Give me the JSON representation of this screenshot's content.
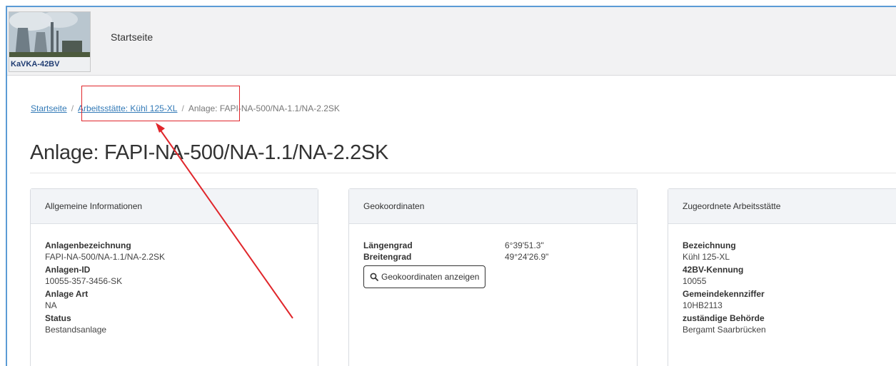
{
  "app": {
    "logo_text": "KaVKA-42BV",
    "nav_home": "Startseite"
  },
  "breadcrumb": {
    "home": "Startseite",
    "worksite": "Arbeitsstätte: Kühl 125-XL",
    "current": "Anlage: FAPI-NA-500/NA-1.1/NA-2.2SK",
    "separator": "/"
  },
  "page_title": "Anlage: FAPI-NA-500/NA-1.1/NA-2.2SK",
  "cards": {
    "general": {
      "title": "Allgemeine Informationen",
      "fields": [
        {
          "label": "Anlagenbezeichnung",
          "value": "FAPI-NA-500/NA-1.1/NA-2.2SK"
        },
        {
          "label": "Anlagen-ID",
          "value": "10055-357-3456-SK"
        },
        {
          "label": "Anlage Art",
          "value": "NA"
        },
        {
          "label": "Status",
          "value": "Bestandsanlage"
        }
      ]
    },
    "geo": {
      "title": "Geokoordinaten",
      "longitude_label": "Längengrad",
      "longitude_value": "6°39'51.3\"",
      "latitude_label": "Breitengrad",
      "latitude_value": "49°24'26.9\"",
      "button_label": "Geokoordinaten anzeigen"
    },
    "worksite": {
      "title": "Zugeordnete Arbeitsstätte",
      "fields": [
        {
          "label": "Bezeichnung",
          "value": "Kühl 125-XL"
        },
        {
          "label": "42BV-Kennung",
          "value": "10055"
        },
        {
          "label": "Gemeindekennziffer",
          "value": "10HB2113"
        },
        {
          "label": "zuständige Behörde",
          "value": "Bergamt Saarbrücken"
        }
      ]
    }
  },
  "colors": {
    "annotation": "#e0262b",
    "link": "#337ab7",
    "card_header_bg": "#f2f4f7"
  }
}
